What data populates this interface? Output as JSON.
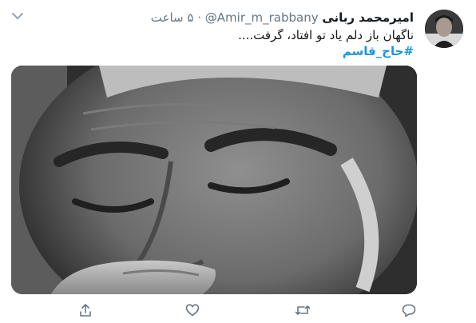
{
  "tweet": {
    "author_name": "امیرمحمد ربانی",
    "handle": "@Amir_m_rabbany",
    "separator": "·",
    "time": "۵ ساعت",
    "text": "ناگهان باز دلم یاد تو افتاد، گرفت....",
    "hashtag": "#حاج_قاسم"
  },
  "icons": {
    "menu": "chevron-down-icon",
    "share": "share-icon",
    "like": "heart-icon",
    "retweet": "retweet-icon",
    "reply": "reply-icon"
  },
  "colors": {
    "text": "#14171a",
    "secondary": "#657786",
    "link": "#1b95e0"
  }
}
